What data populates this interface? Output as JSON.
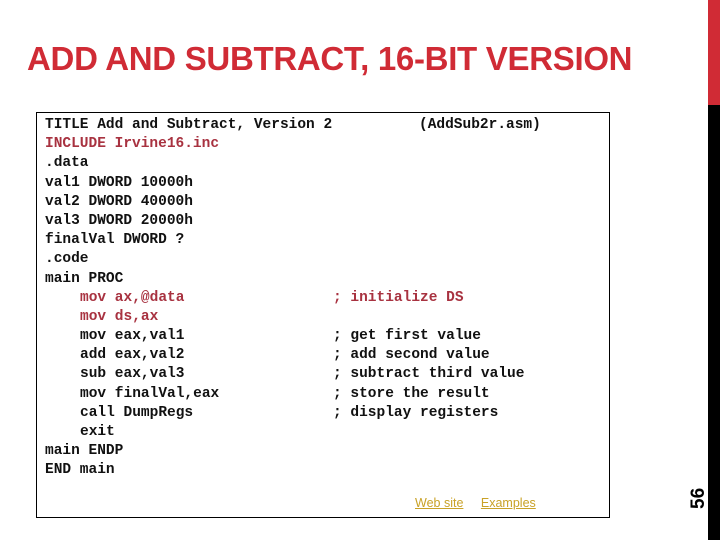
{
  "slide": {
    "title": "ADD AND SUBTRACT, 16-BIT VERSION",
    "page_number": "56",
    "accent_color": "#d02b35"
  },
  "code": {
    "lines": [
      {
        "text": "TITLE Add and Subtract, Version 2",
        "comment": "(AddSub2r.asm)",
        "indent": false,
        "highlight": false
      },
      {
        "text": "INCLUDE Irvine16.inc",
        "comment": "",
        "indent": false,
        "highlight": true
      },
      {
        "text": ".data",
        "comment": "",
        "indent": false,
        "highlight": false
      },
      {
        "text": "val1 DWORD 10000h",
        "comment": "",
        "indent": false,
        "highlight": false
      },
      {
        "text": "val2 DWORD 40000h",
        "comment": "",
        "indent": false,
        "highlight": false
      },
      {
        "text": "val3 DWORD 20000h",
        "comment": "",
        "indent": false,
        "highlight": false
      },
      {
        "text": "finalVal DWORD ?",
        "comment": "",
        "indent": false,
        "highlight": false
      },
      {
        "text": ".code",
        "comment": "",
        "indent": false,
        "highlight": false
      },
      {
        "text": "main PROC",
        "comment": "",
        "indent": false,
        "highlight": false
      },
      {
        "text": "mov ax,@data",
        "comment": "; initialize DS",
        "indent": true,
        "highlight": true
      },
      {
        "text": "mov ds,ax",
        "comment": "",
        "indent": true,
        "highlight": true
      },
      {
        "text": "mov eax,val1",
        "comment": "; get first value",
        "indent": true,
        "highlight": false
      },
      {
        "text": "add eax,val2",
        "comment": "; add second value",
        "indent": true,
        "highlight": false
      },
      {
        "text": "sub eax,val3",
        "comment": "; subtract third value",
        "indent": true,
        "highlight": false
      },
      {
        "text": "mov finalVal,eax",
        "comment": "; store the result",
        "indent": true,
        "highlight": false
      },
      {
        "text": "call DumpRegs",
        "comment": "; display registers",
        "indent": true,
        "highlight": false
      },
      {
        "text": "exit",
        "comment": "",
        "indent": true,
        "highlight": false
      },
      {
        "text": "main ENDP",
        "comment": "",
        "indent": false,
        "highlight": false
      },
      {
        "text": "END main",
        "comment": "",
        "indent": false,
        "highlight": false
      }
    ]
  },
  "links": {
    "web_site": "Web site",
    "examples": "Examples",
    "color": "#c9a227"
  }
}
